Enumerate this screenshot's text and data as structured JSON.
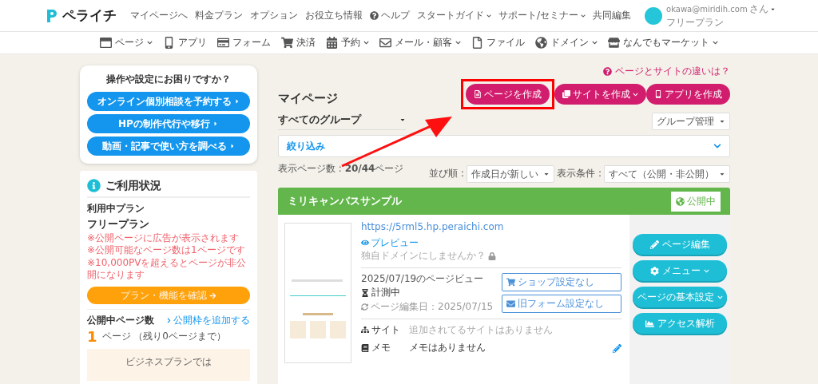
{
  "header": {
    "logo": "ペライチ",
    "links": [
      {
        "label": "マイページへ",
        "caret": false
      },
      {
        "label": "料金プラン",
        "caret": false
      },
      {
        "label": "オプション",
        "caret": false
      },
      {
        "label": "お役立ち情報",
        "caret": false
      },
      {
        "label": "ヘルプ",
        "caret": false
      },
      {
        "label": "スタートガイド",
        "caret": true
      },
      {
        "label": "サポート/セミナー",
        "caret": true
      },
      {
        "label": "共同編集",
        "caret": false
      }
    ],
    "user": {
      "email": "okawa@miridih.com",
      "suffix": "さん",
      "plan": "フリープラン"
    }
  },
  "toolbar": [
    {
      "label": "ページ",
      "caret": true
    },
    {
      "label": "アプリ",
      "caret": false
    },
    {
      "label": "フォーム",
      "caret": false
    },
    {
      "label": "決済",
      "caret": false
    },
    {
      "label": "予約",
      "caret": true
    },
    {
      "label": "メール・顧客",
      "caret": true
    },
    {
      "label": "ファイル",
      "caret": false
    },
    {
      "label": "ドメイン",
      "caret": true
    },
    {
      "label": "なんでもマーケット",
      "caret": true
    }
  ],
  "help_card": {
    "title": "操作や設定にお困りですか？",
    "buttons": [
      "オンライン個別相談を予約する",
      "HPの制作代行や移行",
      "動画・記事で使い方を調べる"
    ]
  },
  "usage": {
    "title": "ご利用状況",
    "plan_label": "利用中プラン",
    "plan_name": "フリープラン",
    "notes": [
      "※公開ページに広告が表示されます",
      "※公開可能なページ数は1ページです",
      "※10,000PVを超えるとページが非公開になります"
    ],
    "plan_button": "プラン・機能を確認",
    "published_label": "公開中ページ数",
    "add_link": "公開枠を追加する",
    "count": "1",
    "count_text": "ページ （残り0ページまで）",
    "promo": "ビジネスプランでは"
  },
  "main": {
    "title": "マイページ",
    "diff_link": "ページとサイトの違いは？",
    "create_buttons": [
      {
        "label": "ページを作成",
        "caret": false,
        "highlighted": true
      },
      {
        "label": "サイトを作成",
        "caret": true,
        "highlighted": false
      },
      {
        "label": "アプリを作成",
        "caret": false,
        "highlighted": false
      }
    ],
    "group_select": "すべてのグループ",
    "group_manage": "グループ管理",
    "filter": "絞り込み",
    "count": "表示ページ数 : **20/44**ページ",
    "sort_label": "並び順 :",
    "sort_value": "作成日が新しい",
    "cond_label": "表示条件 :",
    "cond_value": "すべて（公開・非公開）"
  },
  "page_card": {
    "title": "ミリキャンバスサンプル",
    "status": "公開中",
    "url": "https://5rml5.hp.peraichi.com",
    "preview": "プレビュー",
    "domain_prompt": "独自ドメインにしませんか？",
    "views_label": "2025/07/19のページビュー",
    "measuring": "計測中",
    "edited": "ページ編集日：2025/07/15",
    "shop": "ショップ設定なし",
    "form": "旧フォーム設定なし",
    "site_label": "サイト",
    "site_value": "追加されてるサイトはありません",
    "memo_label": "メモ",
    "memo_value": "メモはありません",
    "actions": [
      {
        "label": "ページ編集",
        "caret": false
      },
      {
        "label": "メニュー",
        "caret": true
      },
      {
        "label": "ページの基本設定",
        "caret": true
      },
      {
        "label": "アクセス解析",
        "caret": false
      }
    ]
  }
}
